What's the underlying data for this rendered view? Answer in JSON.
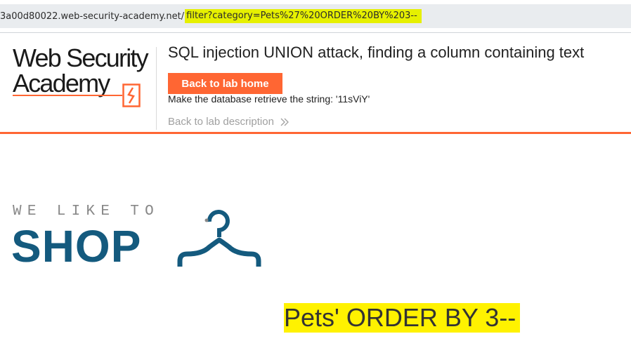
{
  "browser": {
    "url_domain": "3a00d80022.web-security-academy.net/",
    "url_path": "filter?category=Pets%27%20ORDER%20BY%203--"
  },
  "academy": {
    "logo_line1": "Web Security",
    "logo_line2": "Academy",
    "lab_title": "SQL injection UNION attack, finding a column containing text",
    "back_home_label": "Back to lab home",
    "objective": "Make the database retrieve the string: '11sViY'",
    "back_description_label": "Back to lab description",
    "back_description_icon": "double-chevron-right-icon",
    "accent_color": "#ff6633"
  },
  "shop": {
    "tagline": "WE LIKE TO",
    "name": "SHOP",
    "brand_color": "#145a7e",
    "logo_icon": "clothes-hanger-icon"
  },
  "category": {
    "heading": "Pets' ORDER BY 3--",
    "highlight_color": "#fff200"
  }
}
